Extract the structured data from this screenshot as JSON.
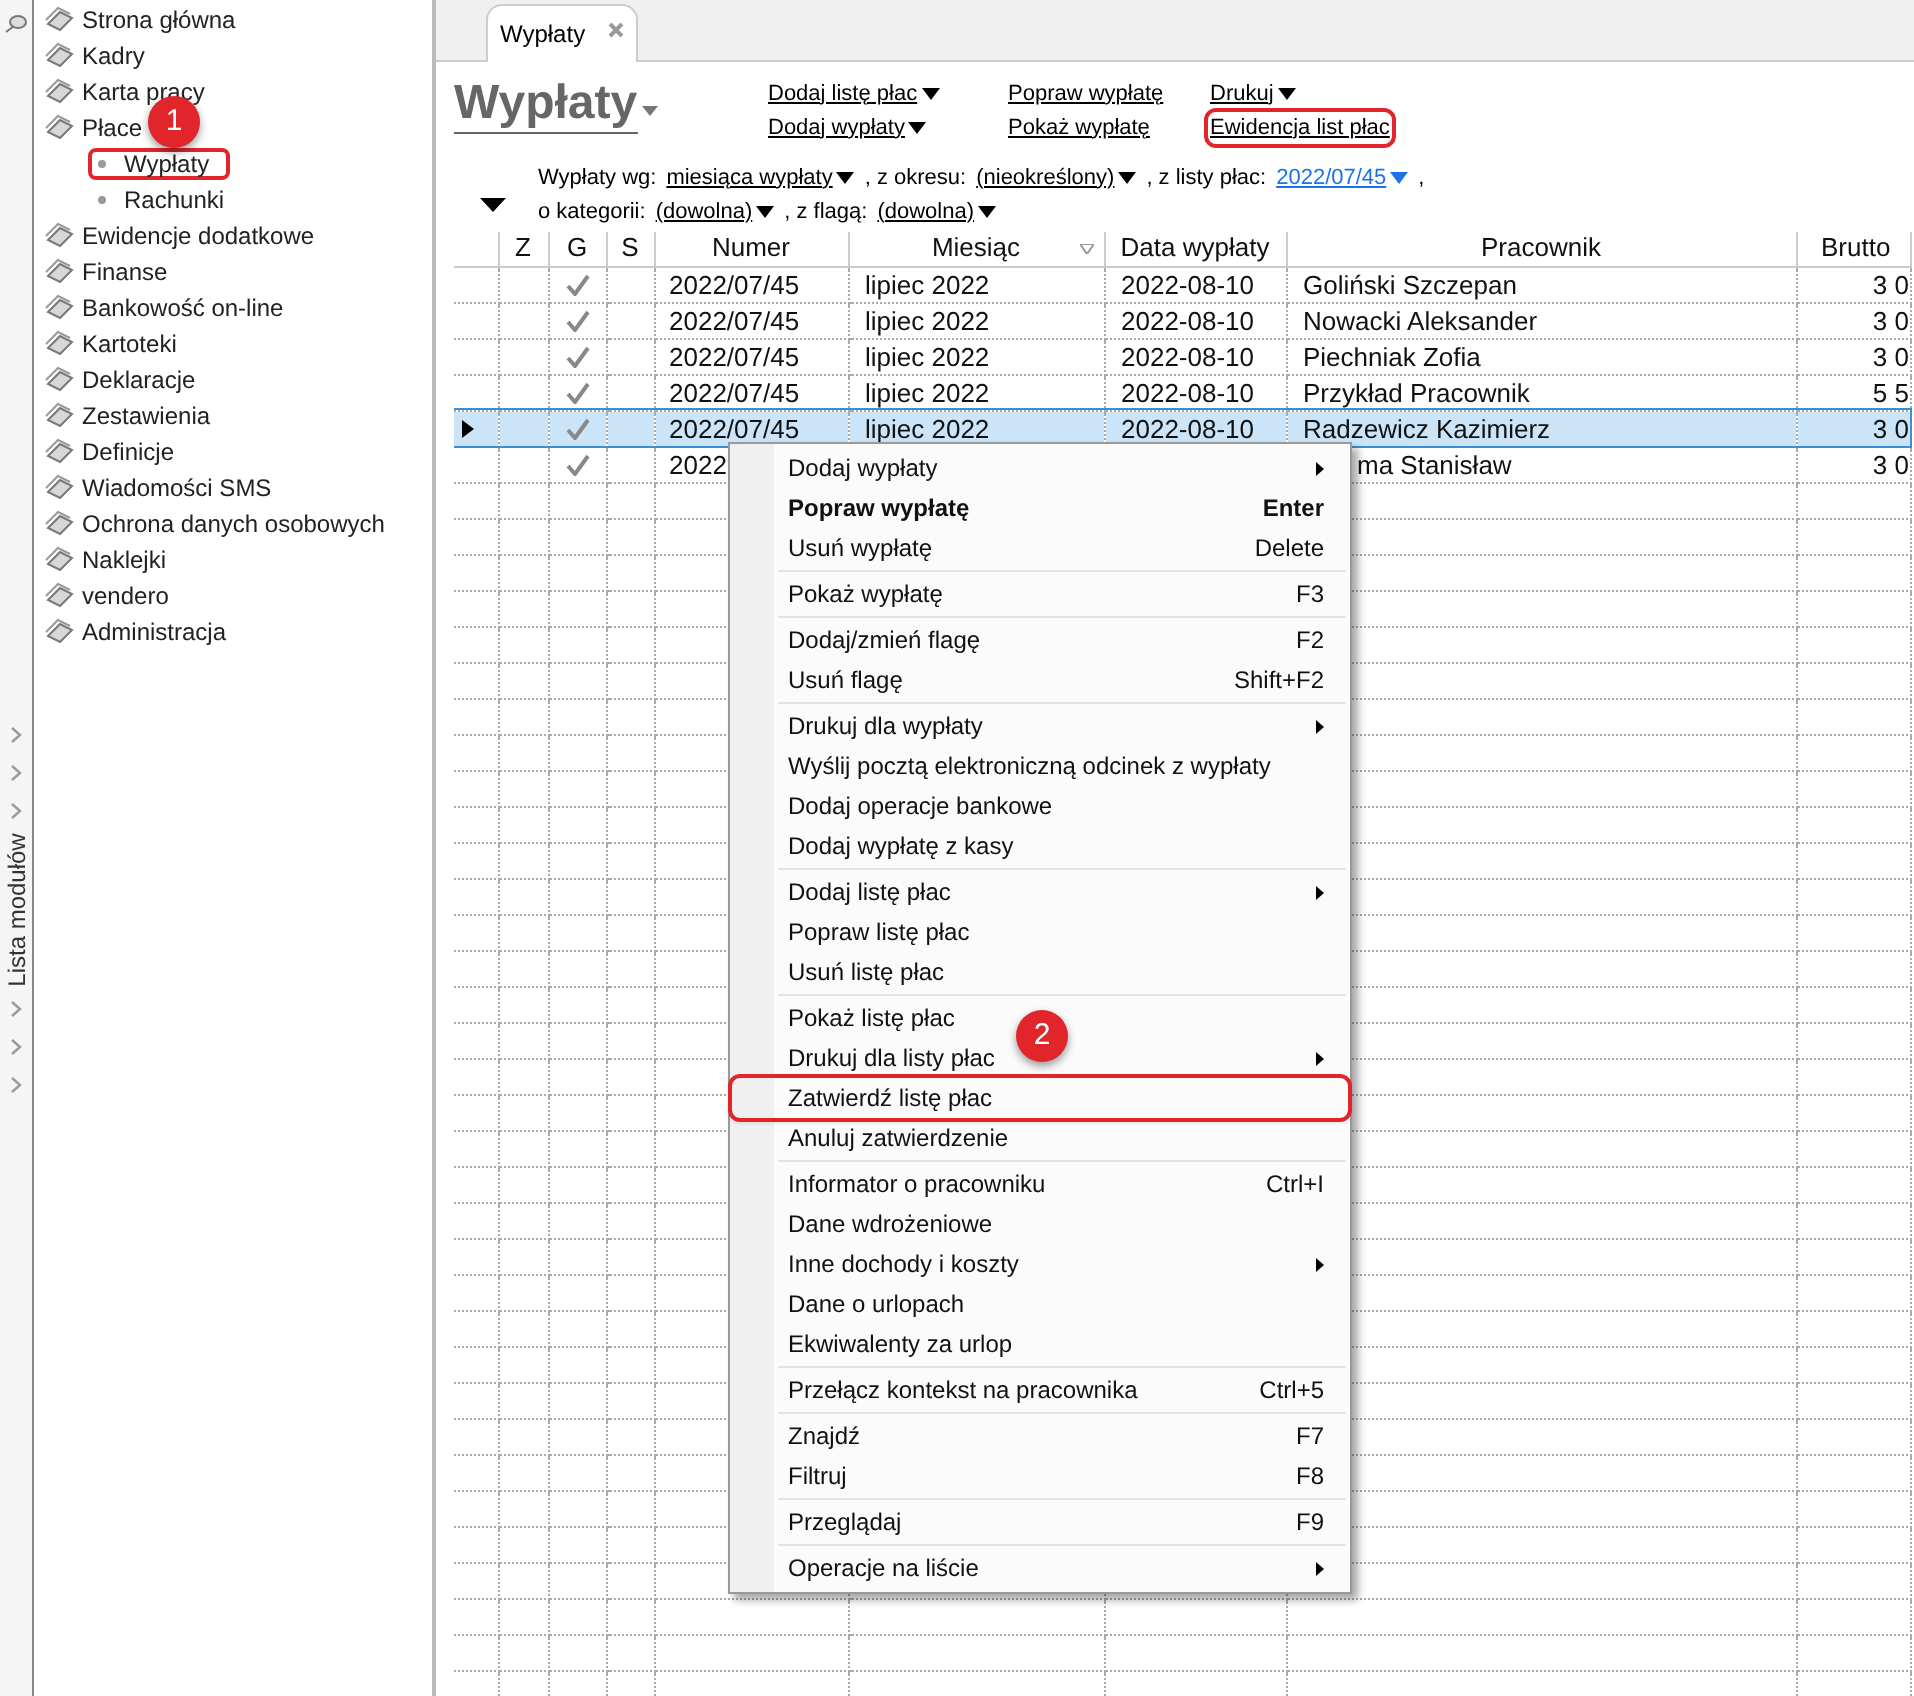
{
  "side_strip": {
    "label": "Lista modułów"
  },
  "sidebar": {
    "items": [
      {
        "label": "Strona główna"
      },
      {
        "label": "Kadry"
      },
      {
        "label": "Karta pracy"
      },
      {
        "label": "Płace",
        "children": [
          {
            "label": "Wypłaty",
            "highlighted": true,
            "annotation": "1"
          },
          {
            "label": "Rachunki",
            "highlighted": false
          }
        ]
      },
      {
        "label": "Ewidencje dodatkowe"
      },
      {
        "label": "Finanse"
      },
      {
        "label": "Bankowość on-line"
      },
      {
        "label": "Kartoteki"
      },
      {
        "label": "Deklaracje"
      },
      {
        "label": "Zestawienia"
      },
      {
        "label": "Definicje"
      },
      {
        "label": "Wiadomości SMS"
      },
      {
        "label": "Ochrona danych osobowych"
      },
      {
        "label": "Naklejki"
      },
      {
        "label": "vendero"
      },
      {
        "label": "Administracja"
      }
    ]
  },
  "tab": {
    "title": "Wypłaty"
  },
  "header": {
    "title": "Wypłaty"
  },
  "actions": [
    [
      {
        "label": "Dodaj listę płac",
        "dropdown": true,
        "highlighted": false
      },
      {
        "label": "Dodaj wypłaty",
        "dropdown": true,
        "highlighted": false
      }
    ],
    [
      {
        "label": "Popraw wypłatę",
        "dropdown": false,
        "highlighted": false
      },
      {
        "label": "Pokaż wypłatę",
        "dropdown": false,
        "highlighted": false
      }
    ],
    [
      {
        "label": "Drukuj",
        "dropdown": true,
        "highlighted": false
      },
      {
        "label": "Ewidencja list płac",
        "dropdown": false,
        "highlighted": true
      }
    ]
  ],
  "filters": [
    [
      {
        "kind": "label",
        "text": "Wypłaty wg:"
      },
      {
        "kind": "dropdown",
        "text": "miesiąca wypłaty"
      },
      {
        "kind": "label",
        "text": ", z okresu:"
      },
      {
        "kind": "dropdown",
        "text": "(nieokreślony)"
      },
      {
        "kind": "label",
        "text": ", z listy płac:"
      },
      {
        "kind": "link",
        "text": "2022/07/45"
      },
      {
        "kind": "label",
        "text": ","
      }
    ],
    [
      {
        "kind": "label",
        "text": "o kategorii:"
      },
      {
        "kind": "dropdown",
        "text": "(dowolna)"
      },
      {
        "kind": "label",
        "text": ", z flagą:"
      },
      {
        "kind": "dropdown",
        "text": "(dowolna)"
      }
    ]
  ],
  "table": {
    "columns": [
      "Z",
      "G",
      "S",
      "Numer",
      "Miesiąc",
      "Data wypłaty",
      "Pracownik",
      "Brutto"
    ],
    "rows": [
      {
        "selected": false,
        "covered": false,
        "g_checked": true,
        "numer": "2022/07/45",
        "miesiac": "lipiec 2022",
        "data": "2022-08-10",
        "pracownik": "Goliński Szczepan",
        "brutto": "3 0"
      },
      {
        "selected": false,
        "covered": false,
        "g_checked": true,
        "numer": "2022/07/45",
        "miesiac": "lipiec 2022",
        "data": "2022-08-10",
        "pracownik": "Nowacki Aleksander",
        "brutto": "3 0"
      },
      {
        "selected": false,
        "covered": false,
        "g_checked": true,
        "numer": "2022/07/45",
        "miesiac": "lipiec 2022",
        "data": "2022-08-10",
        "pracownik": "Piechniak Zofia",
        "brutto": "3 0"
      },
      {
        "selected": false,
        "covered": false,
        "g_checked": true,
        "numer": "2022/07/45",
        "miesiac": "lipiec 2022",
        "data": "2022-08-10",
        "pracownik": "Przykład Pracownik",
        "brutto": "5 5"
      },
      {
        "selected": true,
        "covered": false,
        "g_checked": true,
        "numer": "2022/07/45",
        "miesiac": "lipiec 2022",
        "data": "2022-08-10",
        "pracownik": "Radzewicz Kazimierz",
        "brutto": "3 0"
      },
      {
        "selected": false,
        "covered": true,
        "g_checked": true,
        "numer": "2022",
        "pracownik": "ma Stanisław",
        "brutto": "3 0"
      }
    ]
  },
  "context_menu": {
    "groups": [
      [
        {
          "label": "Dodaj wypłaty",
          "submenu": true,
          "default": false,
          "highlighted": false
        },
        {
          "label": "Popraw wypłatę",
          "shortcut": "Enter",
          "submenu": false,
          "default": true,
          "highlighted": false
        },
        {
          "label": "Usuń wypłatę",
          "shortcut": "Delete",
          "submenu": false,
          "default": false,
          "highlighted": false
        }
      ],
      [
        {
          "label": "Pokaż wypłatę",
          "shortcut": "F3",
          "submenu": false,
          "default": false,
          "highlighted": false
        }
      ],
      [
        {
          "label": "Dodaj/zmień flagę",
          "shortcut": "F2",
          "submenu": false,
          "default": false,
          "highlighted": false
        },
        {
          "label": "Usuń flagę",
          "shortcut": "Shift+F2",
          "submenu": false,
          "default": false,
          "highlighted": false
        }
      ],
      [
        {
          "label": "Drukuj dla wypłaty",
          "submenu": true,
          "default": false,
          "highlighted": false
        },
        {
          "label": "Wyślij pocztą elektroniczną odcinek z wypłaty",
          "submenu": false,
          "default": false,
          "highlighted": false
        },
        {
          "label": "Dodaj operacje bankowe",
          "submenu": false,
          "default": false,
          "highlighted": false
        },
        {
          "label": "Dodaj wypłatę z kasy",
          "submenu": false,
          "default": false,
          "highlighted": false
        }
      ],
      [
        {
          "label": "Dodaj listę płac",
          "submenu": true,
          "default": false,
          "highlighted": false
        },
        {
          "label": "Popraw listę płac",
          "submenu": false,
          "default": false,
          "highlighted": false
        },
        {
          "label": "Usuń listę płac",
          "submenu": false,
          "default": false,
          "highlighted": false
        }
      ],
      [
        {
          "label": "Pokaż listę płac",
          "submenu": false,
          "default": false,
          "highlighted": false
        },
        {
          "label": "Drukuj dla listy płac",
          "submenu": true,
          "default": false,
          "highlighted": false
        },
        {
          "label": "Zatwierdź listę płac",
          "submenu": false,
          "default": false,
          "highlighted": true,
          "annotation": "2"
        },
        {
          "label": "Anuluj zatwierdzenie",
          "submenu": false,
          "default": false,
          "highlighted": false
        }
      ],
      [
        {
          "label": "Informator o pracowniku",
          "shortcut": "Ctrl+I",
          "submenu": false,
          "default": false,
          "highlighted": false
        },
        {
          "label": "Dane wdrożeniowe",
          "submenu": false,
          "default": false,
          "highlighted": false
        },
        {
          "label": "Inne dochody i koszty",
          "submenu": true,
          "default": false,
          "highlighted": false
        },
        {
          "label": "Dane o urlopach",
          "submenu": false,
          "default": false,
          "highlighted": false
        },
        {
          "label": "Ekwiwalenty za urlop",
          "submenu": false,
          "default": false,
          "highlighted": false
        }
      ],
      [
        {
          "label": "Przełącz kontekst na pracownika",
          "shortcut": "Ctrl+5",
          "submenu": false,
          "default": false,
          "highlighted": false
        }
      ],
      [
        {
          "label": "Znajdź",
          "shortcut": "F7",
          "submenu": false,
          "default": false,
          "highlighted": false
        },
        {
          "label": "Filtruj",
          "shortcut": "F8",
          "submenu": false,
          "default": false,
          "highlighted": false
        }
      ],
      [
        {
          "label": "Przeglądaj",
          "shortcut": "F9",
          "submenu": false,
          "default": false,
          "highlighted": false
        }
      ],
      [
        {
          "label": "Operacje na liście",
          "submenu": true,
          "default": false,
          "highlighted": false
        }
      ]
    ]
  }
}
